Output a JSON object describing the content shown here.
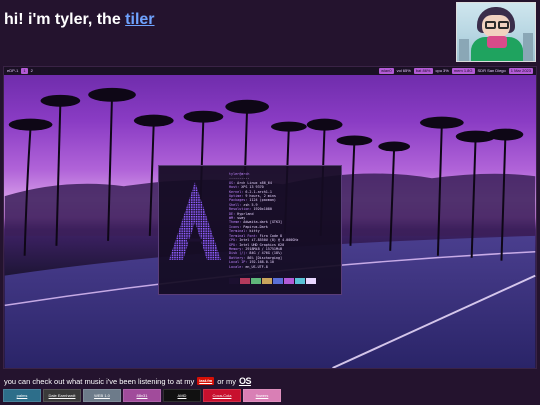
{
  "header": {
    "intro": "hi! i'm tyler, the ",
    "link": "tiler"
  },
  "desktop": {
    "bar": {
      "workspace": "eDP-1",
      "tags": [
        "1",
        "2"
      ],
      "right_items": [
        "wlan0",
        "vol 65%",
        "bat 86%",
        "cpu 3%",
        "mem 1.8G",
        "SDR San Diego",
        "1 Mar 2023"
      ]
    },
    "terminal": {
      "prompt": "tyler@arch",
      "separator": "----------",
      "lines": [
        [
          "OS:",
          "Arch Linux x86_64"
        ],
        [
          "Host:",
          "XPS 13 9370"
        ],
        [
          "Kernel:",
          "6.2.1-arch1-1"
        ],
        [
          "Uptime:",
          "9 hours, 2 mins"
        ],
        [
          "Packages:",
          "1124 (pacman)"
        ],
        [
          "Shell:",
          "zsh 5.9"
        ],
        [
          "Resolution:",
          "1920x1080"
        ],
        [
          "DE:",
          "Hyprland"
        ],
        [
          "WM:",
          "sway"
        ],
        [
          "Theme:",
          "Adwaita-dark [GTK3]"
        ],
        [
          "Icons:",
          "Papirus-Dark"
        ],
        [
          "Terminal:",
          "kitty"
        ],
        [
          "Terminal Font:",
          "Fira Code 8"
        ],
        [
          "CPU:",
          "Intel i7-8550U (8) @ 4.000GHz"
        ],
        [
          "GPU:",
          "Intel UHD Graphics 620"
        ],
        [
          "Memory:",
          "2918MiB / 15751MiB"
        ],
        [
          "Disk (/):",
          "84G / 476G (18%)"
        ],
        [
          "Battery:",
          "86% [Discharging]"
        ],
        [
          "Local IP:",
          "192.168.0.10"
        ],
        [
          "Locale:",
          "en_US.UTF-8"
        ]
      ],
      "swatch_colors": [
        "#1c1030",
        "#b33a5c",
        "#5fb57a",
        "#c9a35c",
        "#5a6fd6",
        "#b35bd6",
        "#5ac2d6",
        "#e8d6ff"
      ]
    }
  },
  "footer": {
    "text_start": "you can check out what music i've been listening to at my",
    "lastfm": "last.fm",
    "text_mid": "or my",
    "os_logo": "OS"
  },
  "badges": [
    {
      "label": "palms",
      "color": "#2d6e8a"
    },
    {
      "label": "Dale Earnhardt",
      "color": "#3a3a3a"
    },
    {
      "label": "WEB 1.0",
      "color": "#6d7b8a"
    },
    {
      "label": "88x31",
      "color": "#a14b9b"
    },
    {
      "label": "AMD",
      "color": "#111111"
    },
    {
      "label": "Coca-Cola",
      "color": "#c8102e"
    },
    {
      "label": "flowers",
      "color": "#d97fb5"
    }
  ]
}
